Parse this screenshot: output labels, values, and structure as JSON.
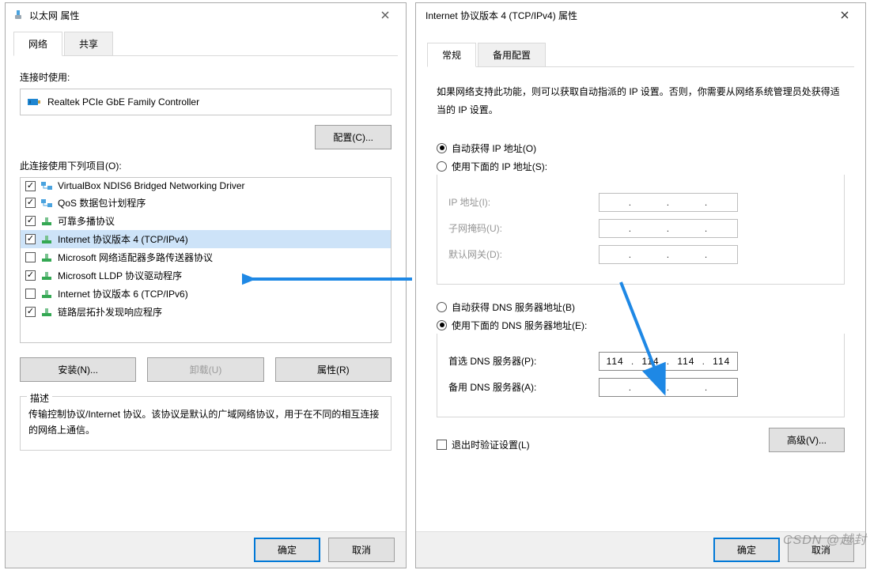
{
  "left": {
    "title": "以太网 属性",
    "tabs": {
      "network": "网络",
      "sharing": "共享"
    },
    "connect_using_label": "连接时使用:",
    "adapter": "Realtek PCIe GbE Family Controller",
    "configure_btn": "配置(C)...",
    "items_label": "此连接使用下列项目(O):",
    "items": [
      {
        "checked": true,
        "label": "VirtualBox NDIS6 Bridged Networking Driver",
        "icon": "net-blue"
      },
      {
        "checked": true,
        "label": "QoS 数据包计划程序",
        "icon": "net-blue"
      },
      {
        "checked": true,
        "label": "可靠多播协议",
        "icon": "net-green"
      },
      {
        "checked": true,
        "label": "Internet 协议版本 4 (TCP/IPv4)",
        "icon": "net-green",
        "selected": true
      },
      {
        "checked": false,
        "label": "Microsoft 网络适配器多路传送器协议",
        "icon": "net-green"
      },
      {
        "checked": true,
        "label": "Microsoft LLDP 协议驱动程序",
        "icon": "net-green"
      },
      {
        "checked": false,
        "label": "Internet 协议版本 6 (TCP/IPv6)",
        "icon": "net-green"
      },
      {
        "checked": true,
        "label": "链路层拓扑发现响应程序",
        "icon": "net-green"
      }
    ],
    "install_btn": "安装(N)...",
    "uninstall_btn": "卸载(U)",
    "properties_btn": "属性(R)",
    "desc_legend": "描述",
    "desc_text": "传输控制协议/Internet 协议。该协议是默认的广域网络协议，用于在不同的相互连接的网络上通信。",
    "ok_btn": "确定",
    "cancel_btn": "取消"
  },
  "right": {
    "title": "Internet 协议版本 4 (TCP/IPv4) 属性",
    "tabs": {
      "general": "常规",
      "alt": "备用配置"
    },
    "intro": "如果网络支持此功能，则可以获取自动指派的 IP 设置。否则，你需要从网络系统管理员处获得适当的 IP 设置。",
    "ip_auto": "自动获得 IP 地址(O)",
    "ip_manual": "使用下面的 IP 地址(S):",
    "ip_addr_label": "IP 地址(I):",
    "subnet_label": "子网掩码(U):",
    "gateway_label": "默认网关(D):",
    "dns_auto": "自动获得 DNS 服务器地址(B)",
    "dns_manual": "使用下面的 DNS 服务器地址(E):",
    "dns_pref_label": "首选 DNS 服务器(P):",
    "dns_alt_label": "备用 DNS 服务器(A):",
    "dns_pref_value": [
      "114",
      "114",
      "114",
      "114"
    ],
    "validate_label": "退出时验证设置(L)",
    "advanced_btn": "高级(V)...",
    "ok_btn": "确定",
    "cancel_btn": "取消"
  },
  "watermark": "CSDN @越封"
}
